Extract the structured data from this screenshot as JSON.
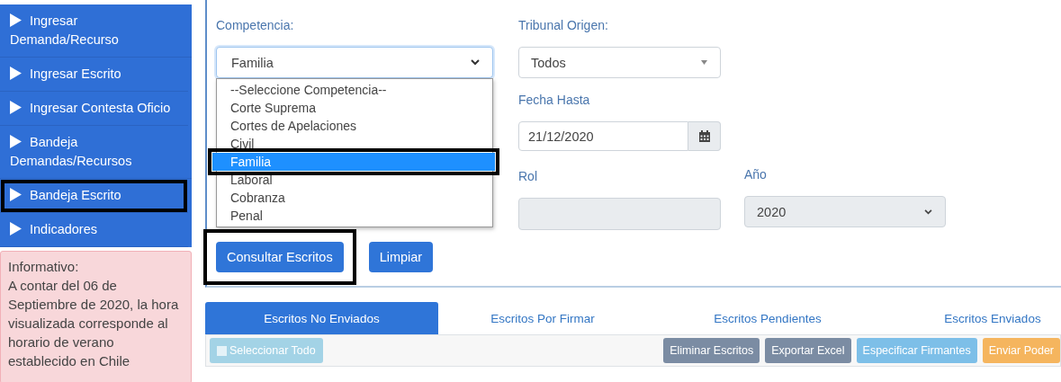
{
  "sidebar": {
    "items": [
      {
        "label": "Ingresar Demanda/Recurso",
        "highlighted": false
      },
      {
        "label": "Ingresar Escrito",
        "highlighted": false
      },
      {
        "label": "Ingresar Contesta Oficio",
        "highlighted": false
      },
      {
        "label": "Bandeja Demandas/Recursos",
        "highlighted": false
      },
      {
        "label": "Bandeja Escrito",
        "highlighted": true
      },
      {
        "label": "Indicadores",
        "highlighted": false
      }
    ],
    "notice": {
      "title": "Informativo:",
      "text": "A contar del 06 de Septiembre de 2020, la hora visualizada corresponde al horario de verano establecido en Chile"
    }
  },
  "form": {
    "competencia": {
      "label": "Competencia:",
      "value": "Familia",
      "options": [
        {
          "label": "--Seleccione Competencia--",
          "selected": false,
          "highlighted": false
        },
        {
          "label": "Corte Suprema",
          "selected": false,
          "highlighted": false
        },
        {
          "label": "Cortes de Apelaciones",
          "selected": false,
          "highlighted": false
        },
        {
          "label": "Civil",
          "selected": false,
          "highlighted": false
        },
        {
          "label": "Familia",
          "selected": true,
          "highlighted": true
        },
        {
          "label": "Laboral",
          "selected": false,
          "highlighted": false
        },
        {
          "label": "Cobranza",
          "selected": false,
          "highlighted": false
        },
        {
          "label": "Penal",
          "selected": false,
          "highlighted": false
        }
      ]
    },
    "tribunal": {
      "label": "Tribunal Origen:",
      "value": "Todos"
    },
    "fecha_hasta": {
      "label": "Fecha Hasta",
      "value": "21/12/2020"
    },
    "rol": {
      "label": "Rol",
      "disabled": true
    },
    "anio": {
      "label": "Año",
      "value": "2020",
      "disabled": true
    }
  },
  "buttons": [
    {
      "label": "Consultar Escritos",
      "highlighted": true
    },
    {
      "label": "Limpiar",
      "highlighted": false
    }
  ],
  "tabs": [
    {
      "label": "Escritos No Enviados",
      "selected": true
    },
    {
      "label": "Escritos Por Firmar",
      "selected": false
    },
    {
      "label": "Escritos Pendientes",
      "selected": false
    },
    {
      "label": "Escritos Enviados",
      "selected": false
    }
  ],
  "toolbar": {
    "select_all": {
      "label": "Seleccionar Todo",
      "disabled": true,
      "checked": false
    },
    "actions": [
      {
        "label": "Eliminar Escritos",
        "color": "#7b8ca3"
      },
      {
        "label": "Exportar Excel",
        "color": "#7b8ca3"
      },
      {
        "label": "Especificar Firmantes",
        "color": "#7dbfe8"
      },
      {
        "label": "Enviar Poder",
        "color": "#f5b55e"
      }
    ]
  }
}
